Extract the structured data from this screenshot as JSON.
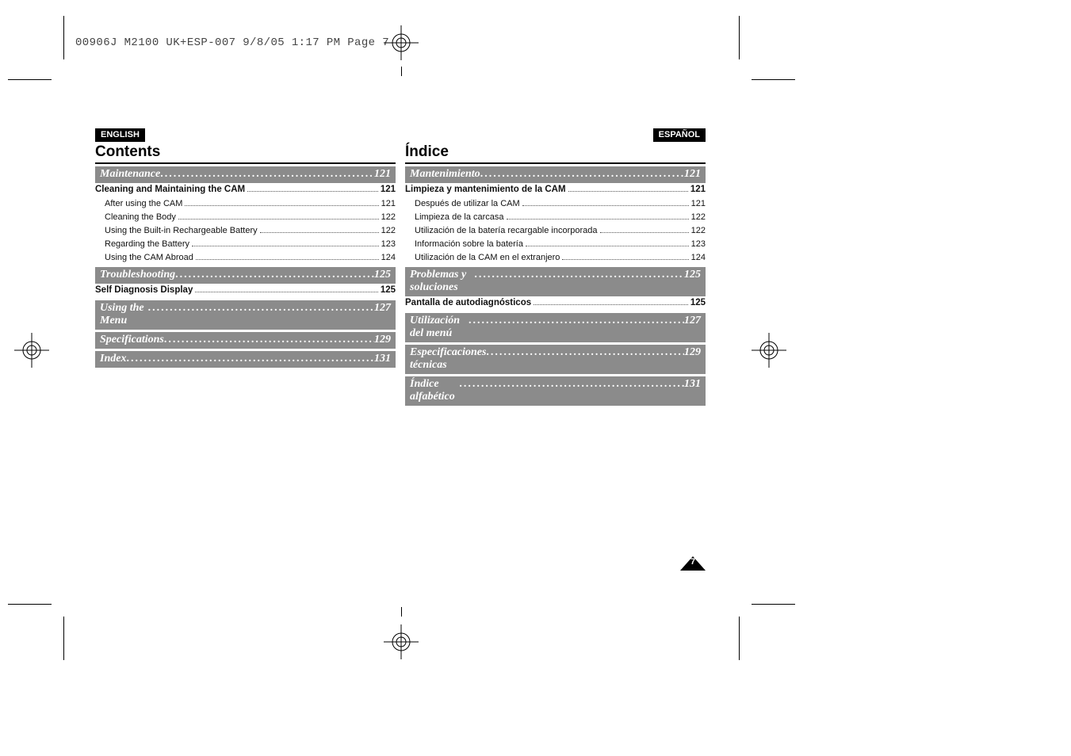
{
  "film_line": "00906J M2100 UK+ESP-007  9/8/05 1:17 PM  Page 7",
  "page_badge": "7",
  "left": {
    "lang_tab": "ENGLISH",
    "section_title": "Contents",
    "groups": [
      {
        "band": {
          "label": "Maintenance",
          "page": "121"
        },
        "rows": [
          {
            "label": "Cleaning and Maintaining the CAM",
            "page": "121",
            "bold": true,
            "indent": 0
          },
          {
            "label": "After using the CAM",
            "page": "121",
            "bold": false,
            "indent": 1
          },
          {
            "label": "Cleaning the Body",
            "page": "122",
            "bold": false,
            "indent": 1
          },
          {
            "label": "Using the Built-in Rechargeable Battery",
            "page": "122",
            "bold": false,
            "indent": 1
          },
          {
            "label": "Regarding the Battery",
            "page": "123",
            "bold": false,
            "indent": 1
          },
          {
            "label": "Using the CAM Abroad",
            "page": "124",
            "bold": false,
            "indent": 1
          }
        ]
      },
      {
        "band": {
          "label": "Troubleshooting",
          "page": "125"
        },
        "rows": [
          {
            "label": "Self Diagnosis Display",
            "page": "125",
            "bold": true,
            "indent": 0
          }
        ]
      },
      {
        "band": {
          "label": "Using the Menu",
          "page": "127"
        },
        "rows": []
      },
      {
        "band": {
          "label": "Specifications",
          "page": "129"
        },
        "rows": []
      },
      {
        "band": {
          "label": "Index",
          "page": "131"
        },
        "rows": []
      }
    ]
  },
  "right": {
    "lang_tab": "ESPAÑOL",
    "section_title": "Índice",
    "groups": [
      {
        "band": {
          "label": "Mantenimiento",
          "page": "121"
        },
        "rows": [
          {
            "label": "Limpieza y mantenimiento de la CAM",
            "page": "121",
            "bold": true,
            "indent": 0
          },
          {
            "label": "Después de utilizar la CAM",
            "page": "121",
            "bold": false,
            "indent": 1
          },
          {
            "label": "Limpieza de la carcasa",
            "page": "122",
            "bold": false,
            "indent": 1
          },
          {
            "label": "Utilización de la batería recargable incorporada",
            "page": "122",
            "bold": false,
            "indent": 1
          },
          {
            "label": "Información sobre la batería",
            "page": "123",
            "bold": false,
            "indent": 1
          },
          {
            "label": "Utilización de la CAM en el extranjero",
            "page": "124",
            "bold": false,
            "indent": 1
          }
        ]
      },
      {
        "band": {
          "label": "Problemas y soluciones",
          "page": "125"
        },
        "rows": [
          {
            "label": "Pantalla de autodiagnósticos",
            "page": "125",
            "bold": true,
            "indent": 0
          }
        ]
      },
      {
        "band": {
          "label": "Utilización del menú",
          "page": "127"
        },
        "rows": []
      },
      {
        "band": {
          "label": "Especificaciones técnicas",
          "page": "129"
        },
        "rows": []
      },
      {
        "band": {
          "label": "Índice alfabético",
          "page": "131"
        },
        "rows": []
      }
    ]
  }
}
